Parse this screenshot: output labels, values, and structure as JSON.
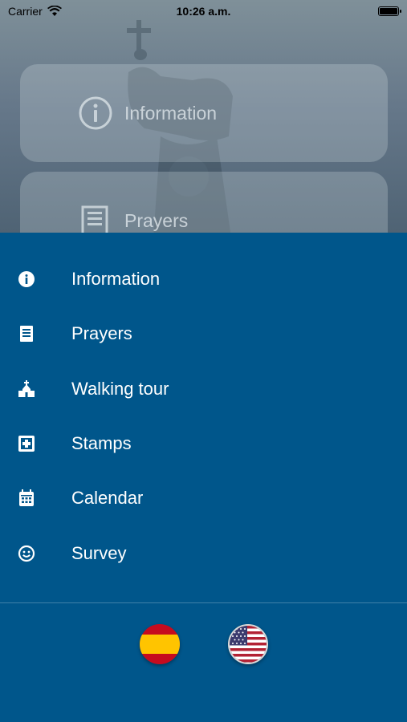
{
  "status_bar": {
    "carrier": "Carrier",
    "time": "10:26 a.m."
  },
  "background_cards": [
    {
      "label": "Information",
      "icon": "info-icon"
    },
    {
      "label": "Prayers",
      "icon": "prayer-book-icon"
    }
  ],
  "menu": {
    "items": [
      {
        "label": "Information",
        "icon": "info-icon"
      },
      {
        "label": "Prayers",
        "icon": "prayer-book-icon"
      },
      {
        "label": "Walking tour",
        "icon": "church-icon"
      },
      {
        "label": "Stamps",
        "icon": "stamp-icon"
      },
      {
        "label": "Calendar",
        "icon": "calendar-icon"
      },
      {
        "label": "Survey",
        "icon": "smiley-icon"
      }
    ],
    "languages": [
      "spanish-flag-icon",
      "us-flag-icon"
    ]
  },
  "colors": {
    "menu_background": "#00568b",
    "menu_text": "#ffffff"
  }
}
